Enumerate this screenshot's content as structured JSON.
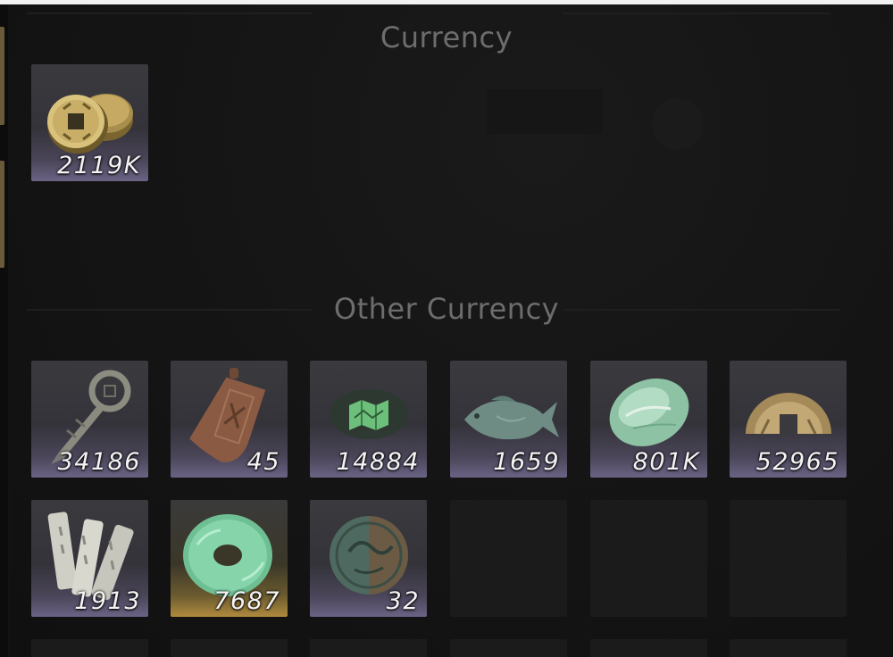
{
  "sections": {
    "currency_title": "Currency",
    "other_currency_title": "Other Currency"
  },
  "currency_items": [
    {
      "icon": "coin-stack-icon",
      "quantity": "2119K"
    }
  ],
  "other_currency_items": [
    {
      "icon": "coin-sword-icon",
      "quantity": "34186"
    },
    {
      "icon": "bronze-token-icon",
      "quantity": "45"
    },
    {
      "icon": "jade-map-icon",
      "quantity": "14884"
    },
    {
      "icon": "jade-fish-icon",
      "quantity": "1659"
    },
    {
      "icon": "jade-stone-icon",
      "quantity": "801K"
    },
    {
      "icon": "half-coin-icon",
      "quantity": "52965"
    },
    {
      "icon": "bamboo-slips-icon",
      "quantity": "1913"
    },
    {
      "icon": "jade-disc-icon",
      "quantity": "7687"
    },
    {
      "icon": "dragon-coin-icon",
      "quantity": "32"
    }
  ],
  "colors": {
    "background": "#121212",
    "slot_common": "#6a6384",
    "slot_rare": "#b08a3e",
    "title_text": "#6d6d6d",
    "quantity_text": "#f4f4f4"
  }
}
